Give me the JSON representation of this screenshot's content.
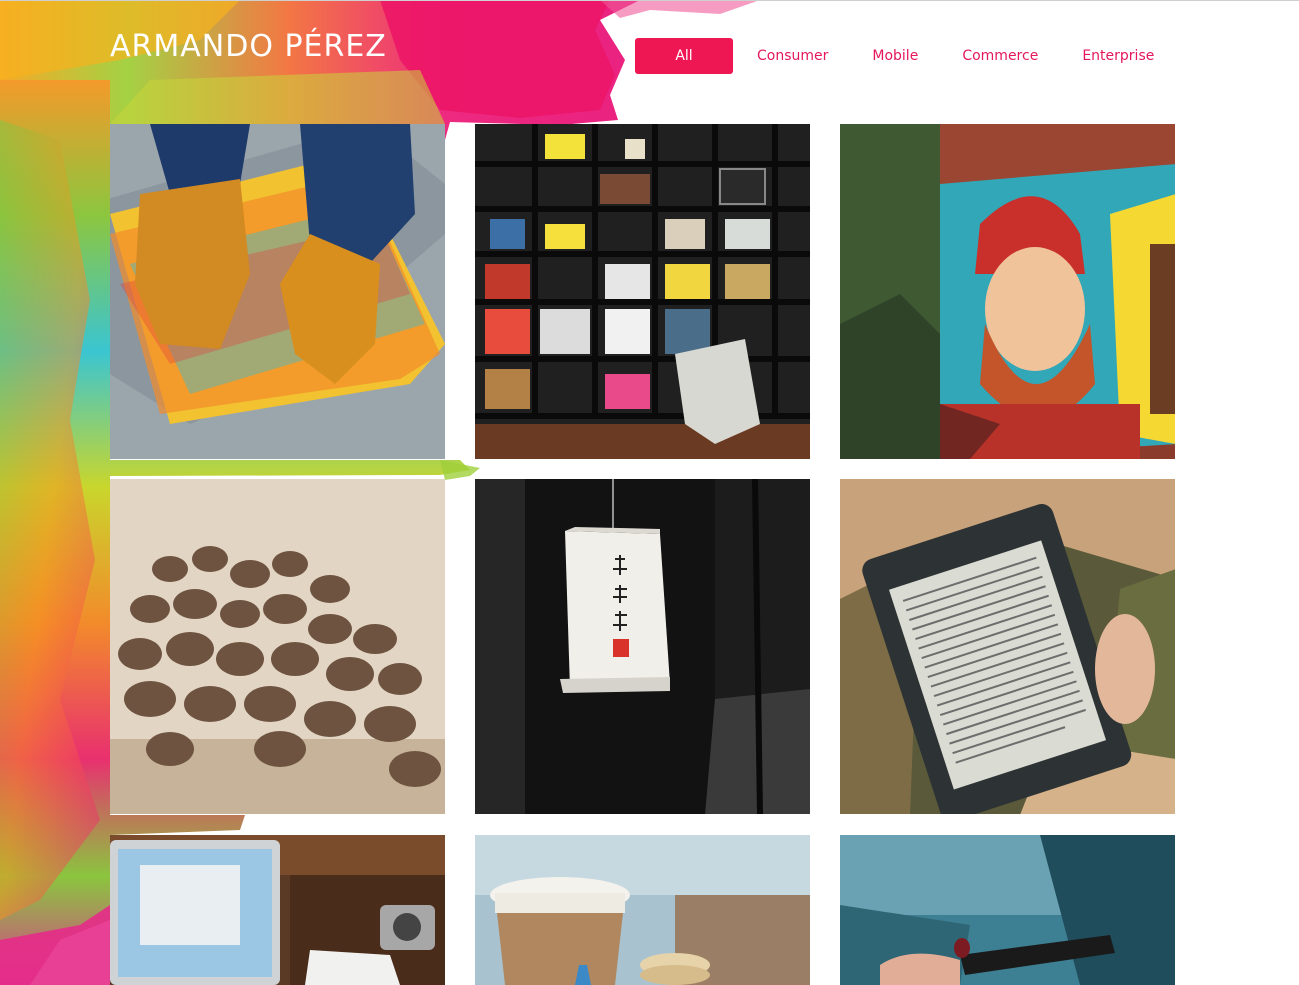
{
  "site": {
    "brand": "ARMANDO PÉREZ"
  },
  "filters": {
    "items": [
      {
        "label": "All",
        "active": true
      },
      {
        "label": "Consumer",
        "active": false
      },
      {
        "label": "Mobile",
        "active": false
      },
      {
        "label": "Commerce",
        "active": false
      },
      {
        "label": "Enterprise",
        "active": false
      }
    ]
  },
  "theme": {
    "accent": "#ee1653",
    "accent_text": "#e4185a",
    "brand_text": "#ffffff"
  },
  "portfolio": {
    "items": [
      {
        "subject": "skateboard-shoes"
      },
      {
        "subject": "bookshelf"
      },
      {
        "subject": "bearded-man-mural"
      },
      {
        "subject": "coffee-beans"
      },
      {
        "subject": "paper-lantern"
      },
      {
        "subject": "kindle-reader"
      },
      {
        "subject": "laptop-desk"
      },
      {
        "subject": "coffee-cup-macarons"
      },
      {
        "subject": "hand-with-phone"
      }
    ]
  }
}
